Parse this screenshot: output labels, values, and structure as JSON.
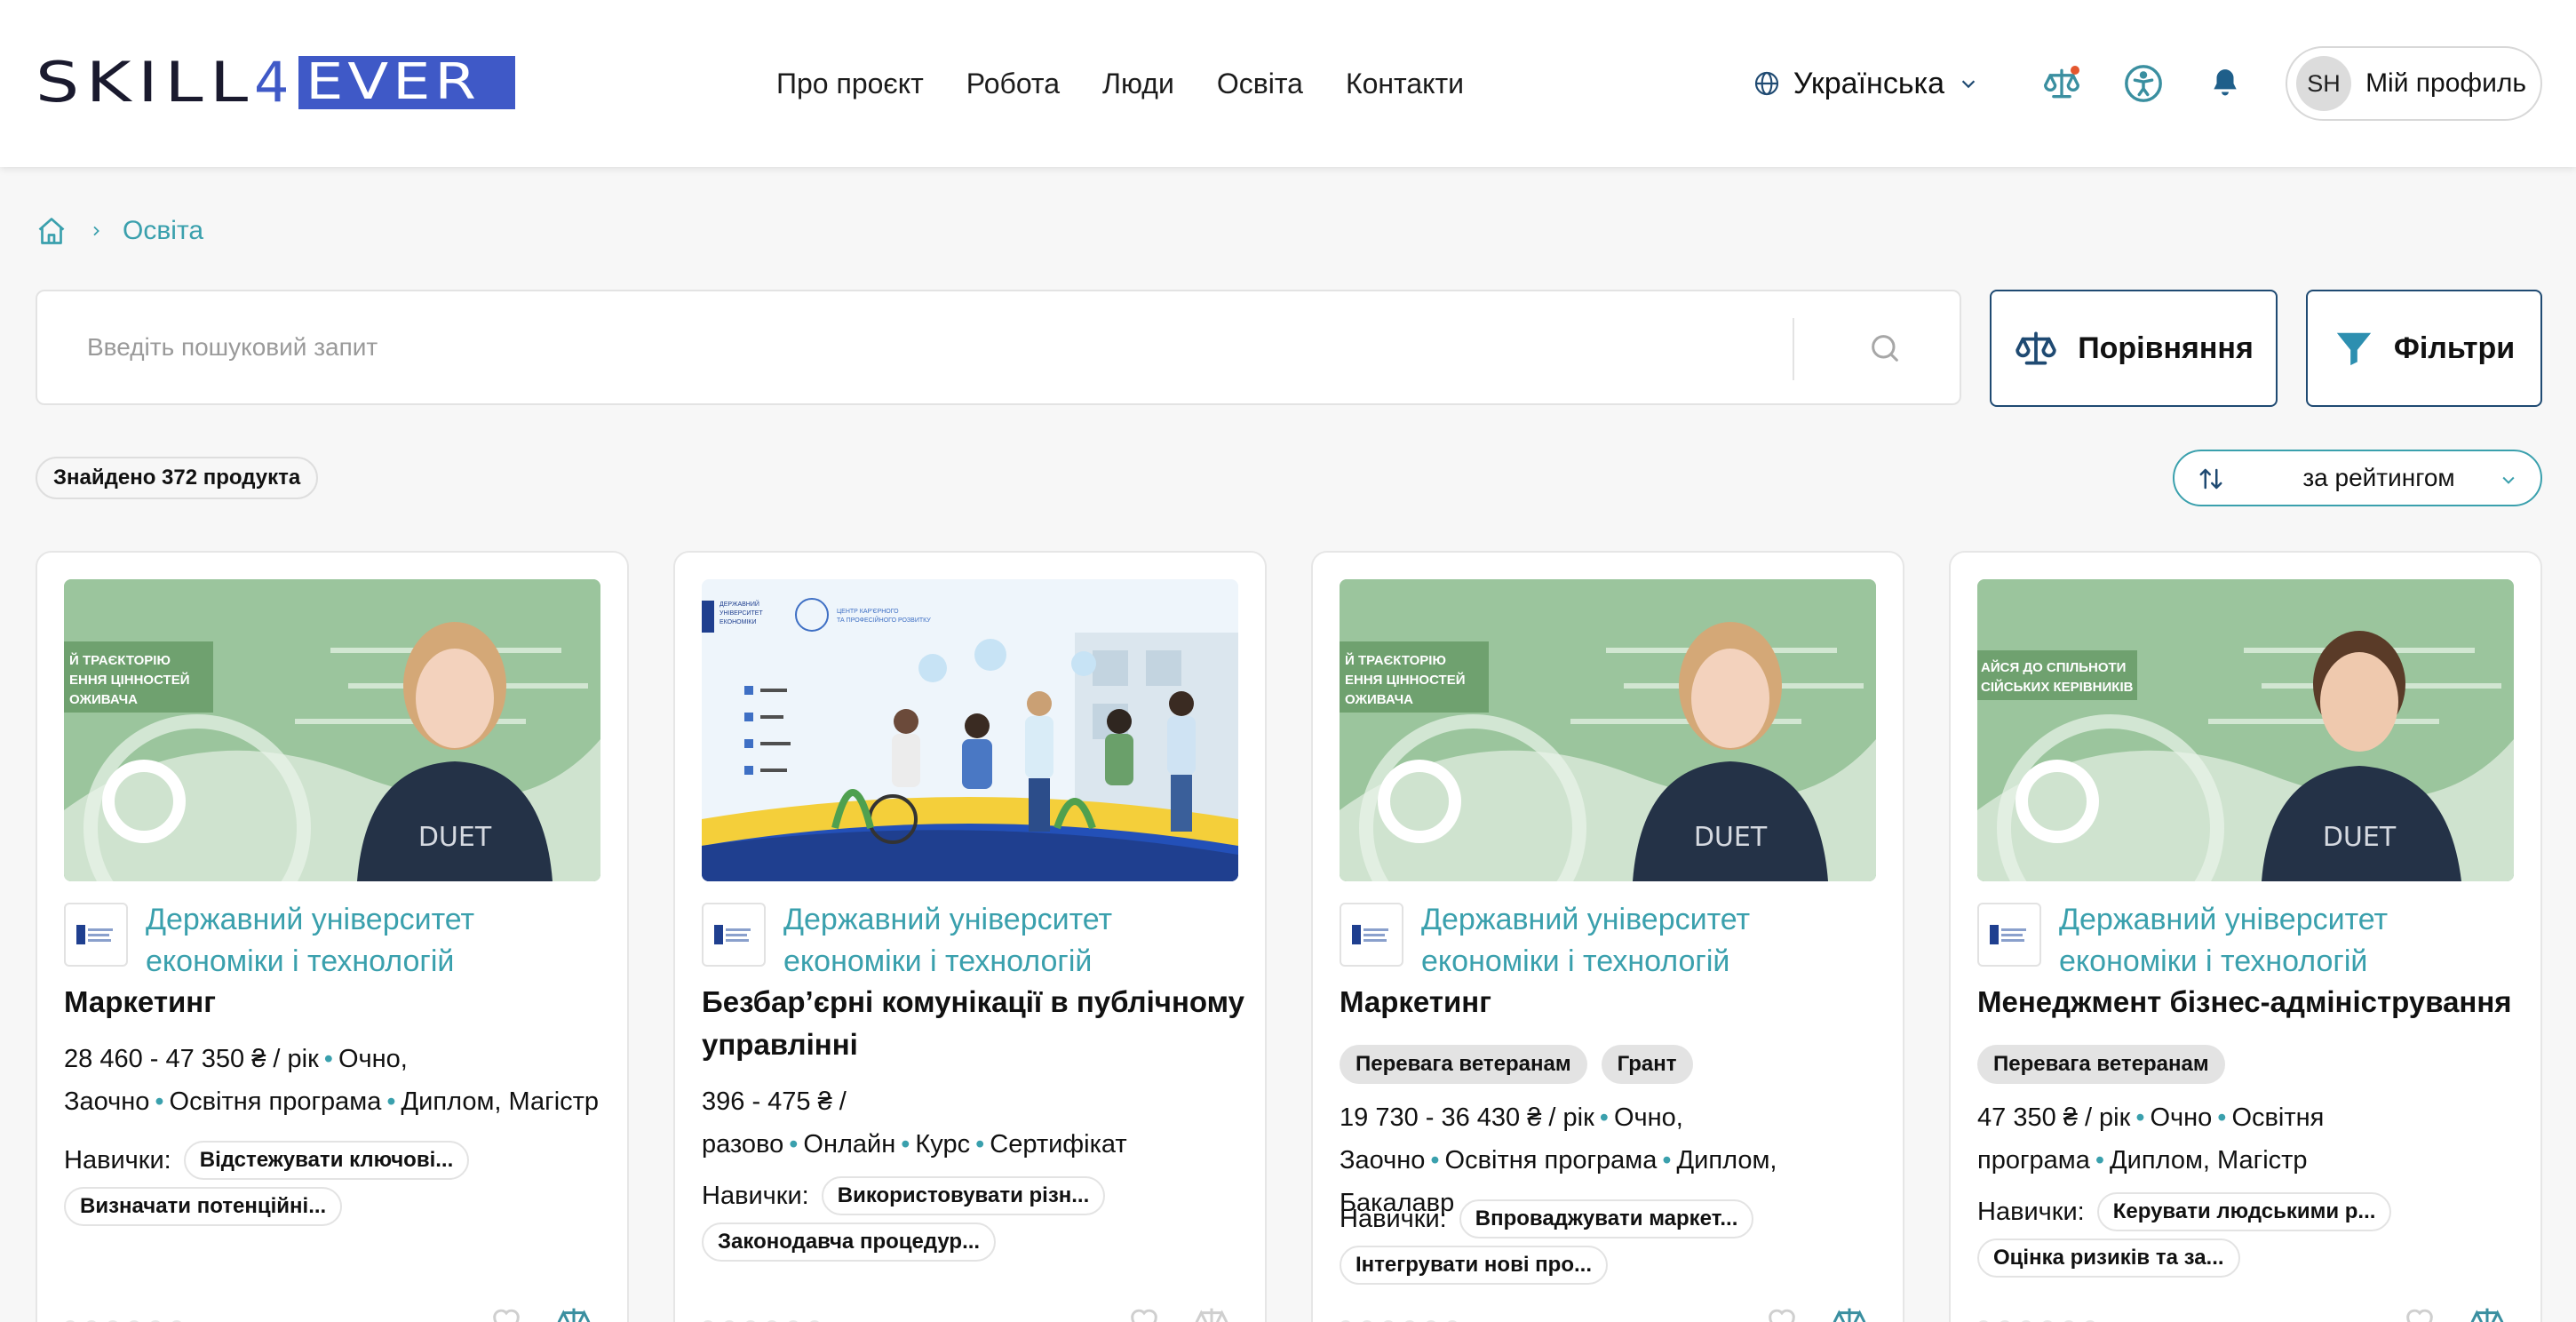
{
  "header": {
    "logo": {
      "left": "SKILL",
      "four": "4",
      "right": "EVER"
    },
    "nav": [
      "Про проєкт",
      "Робота",
      "Люди",
      "Освіта",
      "Контакти"
    ],
    "language": "Українська",
    "avatar_initials": "SH",
    "profile_label": "Мій профиль"
  },
  "breadcrumb": {
    "current": "Освіта"
  },
  "search": {
    "placeholder": "Введіть пошуковий запит",
    "value": ""
  },
  "buttons": {
    "compare": "Порівняння",
    "filters": "Фільтри"
  },
  "results": {
    "found": "Знайдено 372 продукта",
    "sort": "за рейтингом"
  },
  "colors": {
    "accent": "#3aa0ad",
    "brand": "#3f59c7",
    "dark_border": "#1f4a72"
  },
  "cards": [
    {
      "university": "Державний університет економіки і технологій",
      "title": "Маркетинг",
      "badges": [],
      "meta": [
        "28 460 - 47 350 ₴ / рік",
        "Очно, Заочно",
        "Освітня програма",
        "Диплом, Магістр"
      ],
      "skills_label": "Навички:",
      "skills": [
        "Відстежувати ключові...",
        "Визначати потенційні..."
      ],
      "image_banner": [
        "Й ТРАЄКТОРІЮ",
        "ЕННЯ ЦІННОСТЕЙ",
        "ОЖИВАЧА"
      ]
    },
    {
      "university": "Державний університет економіки і технологій",
      "title": "Безбар’єрні комунікації в публічному управлінні",
      "badges": [],
      "meta": [
        "396 - 475 ₴ / разово",
        "Онлайн",
        "Курс",
        "Сертифікат"
      ],
      "skills_label": "Навички:",
      "skills": [
        "Використовувати різн...",
        "Законодавча процедур..."
      ],
      "image_banner": []
    },
    {
      "university": "Державний університет економіки і технологій",
      "title": "Маркетинг",
      "badges": [
        "Перевага ветеранам",
        "Грант"
      ],
      "meta": [
        "19 730 - 36 430 ₴ / рік",
        "Очно, Заочно",
        "Освітня програма",
        "Диплом, Бакалавр"
      ],
      "skills_label": "Навички:",
      "skills": [
        "Впроваджувати маркет...",
        "Інтегрувати нові про..."
      ],
      "image_banner": [
        "Й ТРАЄКТОРІЮ",
        "ЕННЯ ЦІННОСТЕЙ",
        "ОЖИВАЧА"
      ]
    },
    {
      "university": "Державний університет економіки і технологій",
      "title": "Менеджмент бізнес-адміністрування",
      "badges": [
        "Перевага ветеранам"
      ],
      "meta": [
        "47 350 ₴ / рік",
        "Очно",
        "Освітня програма",
        "Диплом, Магістр"
      ],
      "skills_label": "Навички:",
      "skills": [
        "Керувати людськими р...",
        "Оцінка ризиків та за..."
      ],
      "image_banner": [
        "АЙСЯ ДО СПІЛЬНОТИ",
        "СІЙСЬКИХ КЕРІВНИКІВ"
      ]
    }
  ]
}
